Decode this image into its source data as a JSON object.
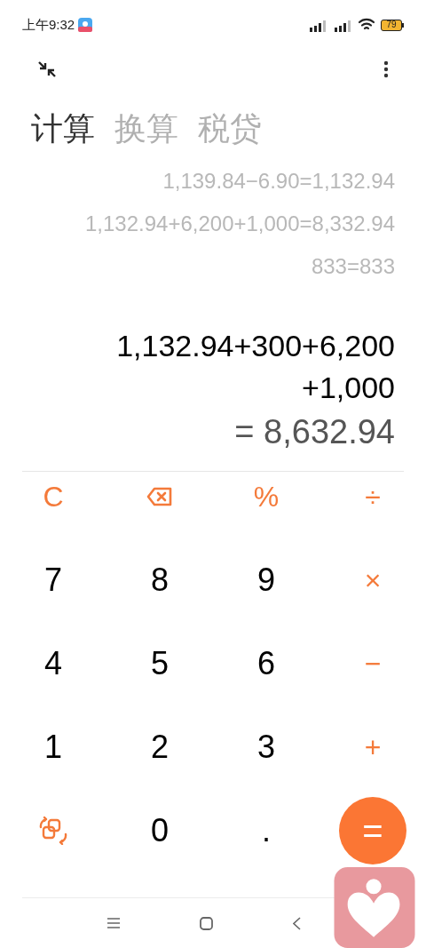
{
  "status_bar": {
    "time": "上午9:32",
    "battery": "79"
  },
  "tabs": [
    {
      "label": "计算",
      "selected": true
    },
    {
      "label": "换算",
      "selected": false
    },
    {
      "label": "税贷",
      "selected": false
    }
  ],
  "history": [
    "1,139.84−6.90=1,132.94",
    "1,132.94+6,200+1,000=8,332.94",
    "833=833"
  ],
  "expression": [
    "1,132.94+300+6,200",
    "+1,000"
  ],
  "result": "= 8,632.94",
  "keys": [
    {
      "kind": "operator",
      "label": "C"
    },
    {
      "kind": "backspace"
    },
    {
      "kind": "operator",
      "label": "%"
    },
    {
      "kind": "operator",
      "label": "÷"
    },
    {
      "kind": "digit",
      "label": "7"
    },
    {
      "kind": "digit",
      "label": "8"
    },
    {
      "kind": "digit",
      "label": "9"
    },
    {
      "kind": "operator",
      "label": "×"
    },
    {
      "kind": "digit",
      "label": "4"
    },
    {
      "kind": "digit",
      "label": "5"
    },
    {
      "kind": "digit",
      "label": "6"
    },
    {
      "kind": "operator",
      "label": "−"
    },
    {
      "kind": "digit",
      "label": "1"
    },
    {
      "kind": "digit",
      "label": "2"
    },
    {
      "kind": "digit",
      "label": "3"
    },
    {
      "kind": "operator",
      "label": "+"
    },
    {
      "kind": "swap"
    },
    {
      "kind": "digit",
      "label": "0"
    },
    {
      "kind": "digit",
      "label": "."
    },
    {
      "kind": "equals",
      "label": "="
    }
  ]
}
